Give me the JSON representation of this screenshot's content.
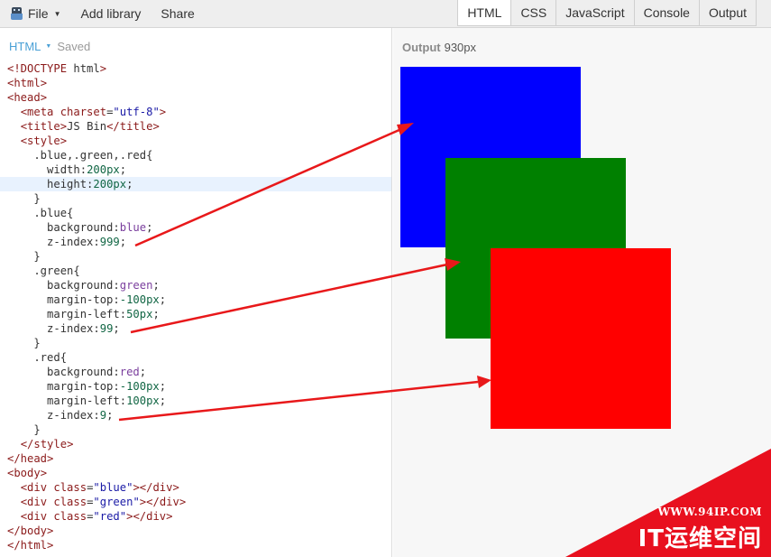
{
  "toolbar": {
    "file_label": "File",
    "add_library_label": "Add library",
    "share_label": "Share",
    "tabs": [
      {
        "label": "HTML",
        "active": true
      },
      {
        "label": "CSS",
        "active": false
      },
      {
        "label": "JavaScript",
        "active": false
      },
      {
        "label": "Console",
        "active": false
      },
      {
        "label": "Output",
        "active": false
      }
    ]
  },
  "editor": {
    "panel_label": "HTML",
    "status": "Saved",
    "highlighted_line": 9,
    "lines": [
      "<!DOCTYPE html>",
      "<html>",
      "<head>",
      "  <meta charset=\"utf-8\">",
      "  <title>JS Bin</title>",
      "  <style>",
      "    .blue,.green,.red{",
      "      width:200px;",
      "      height:200px;",
      "    }",
      "    .blue{",
      "      background:blue;",
      "      z-index:999;",
      "    }",
      "    .green{",
      "      background:green;",
      "      margin-top:-100px;",
      "      margin-left:50px;",
      "      z-index:99;",
      "    }",
      "    .red{",
      "      background:red;",
      "      margin-top:-100px;",
      "      margin-left:100px;",
      "      z-index:9;",
      "    }",
      "  </style>",
      "</head>",
      "<body>",
      "  <div class=\"blue\"></div>",
      "  <div class=\"green\"></div>",
      "  <div class=\"red\"></div>",
      "</body>",
      "</html>"
    ]
  },
  "output": {
    "label": "Output",
    "width_readout": "930px",
    "boxes": [
      {
        "name": "blue",
        "color": "#0000ff"
      },
      {
        "name": "green",
        "color": "#008000"
      },
      {
        "name": "red",
        "color": "#ff0000"
      }
    ]
  },
  "annotations": {
    "arrow_color": "#e8181a",
    "count": 3
  },
  "watermark": {
    "url": "WWW.94IP.COM",
    "name": "IT运维空间",
    "color": "#e8101e"
  },
  "colors": {
    "editor_label": "#4aa0d6",
    "tag": "#8b1a1a",
    "string": "#1a1aa6",
    "number": "#116644",
    "keyword_value": "#7a3e9d",
    "line_highlight": "#e8f2fe"
  }
}
